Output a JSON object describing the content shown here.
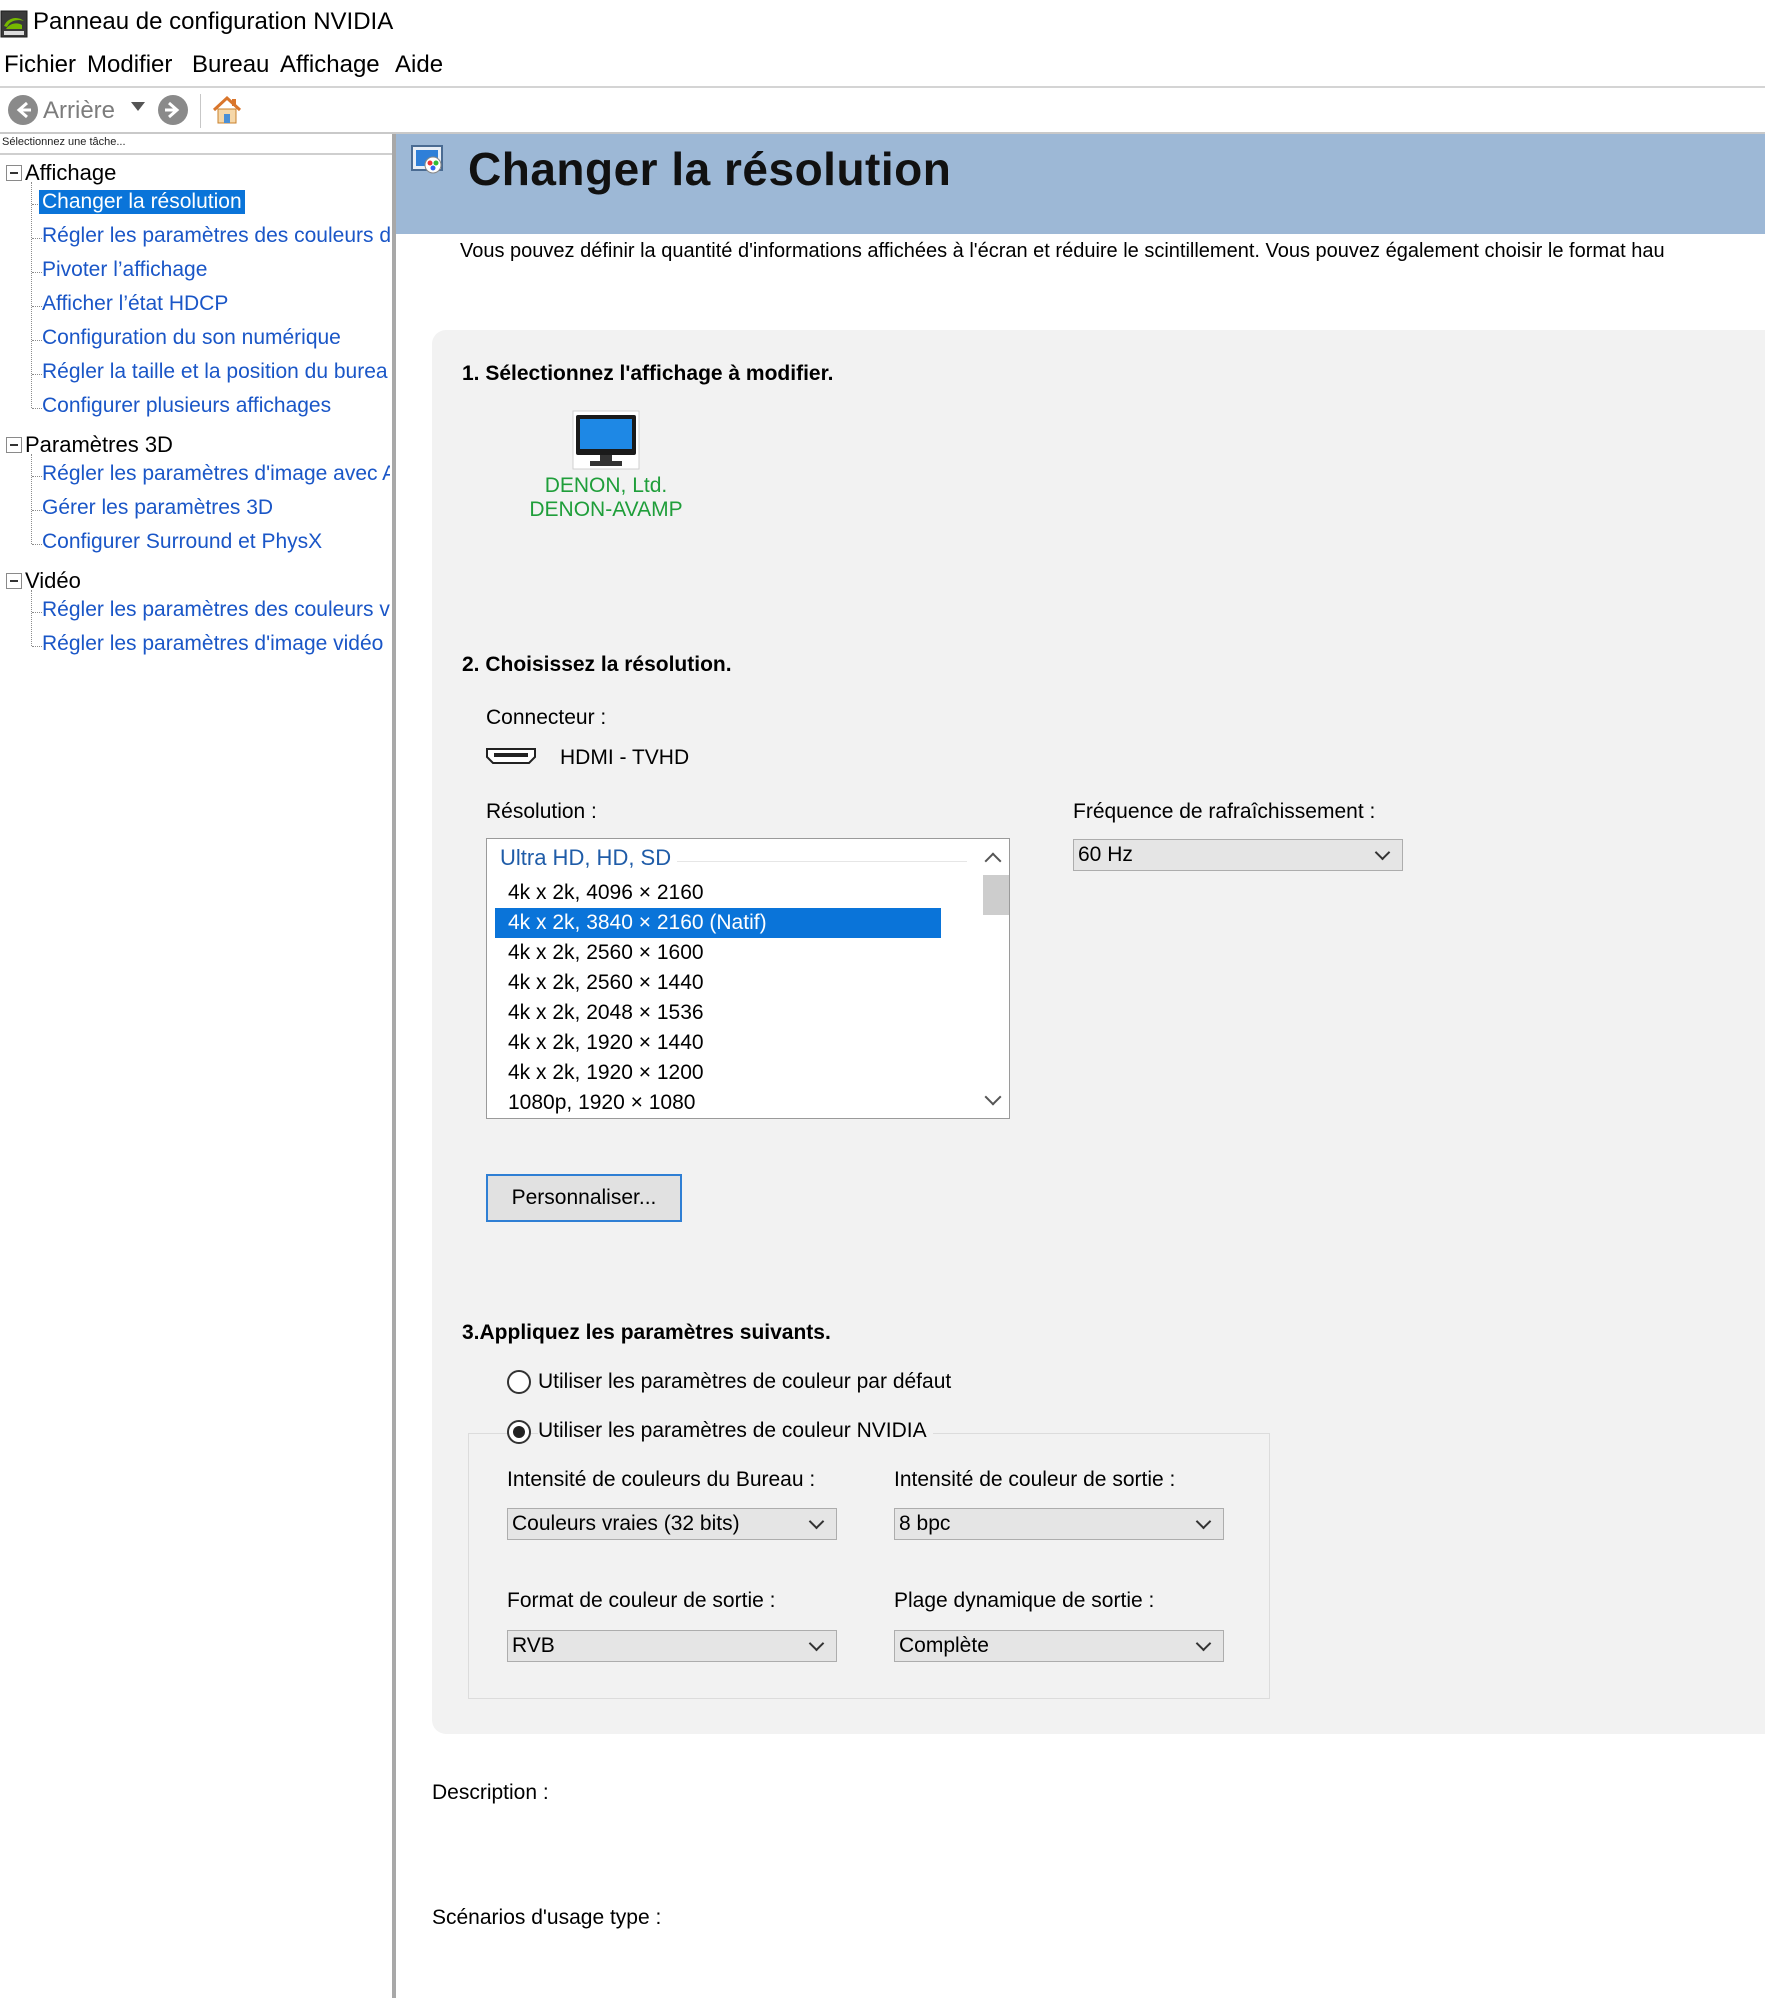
{
  "window": {
    "title": "Panneau de configuration NVIDIA"
  },
  "menu": [
    "Fichier",
    "Modifier",
    "Bureau",
    "Affichage",
    "Aide"
  ],
  "toolbar": {
    "back_label": "Arrière"
  },
  "left_pane": {
    "header": "Sélectionnez une tâche...",
    "categories": [
      {
        "label": "Affichage",
        "items": [
          "Changer la résolution",
          "Régler les paramètres des couleurs d",
          "Pivoter l’affichage",
          "Afficher l’état HDCP",
          "Configuration du son numérique",
          "Régler la taille et la position du burea",
          "Configurer plusieurs affichages"
        ]
      },
      {
        "label": "Paramètres 3D",
        "items": [
          "Régler les paramètres d'image avec A",
          "Gérer les paramètres 3D",
          "Configurer Surround et PhysX"
        ]
      },
      {
        "label": "Vidéo",
        "items": [
          "Régler les paramètres des couleurs v",
          "Régler les paramètres d'image vidéo"
        ]
      }
    ],
    "selected_item": "Changer la résolution"
  },
  "page": {
    "title": "Changer la résolution",
    "intro": "Vous pouvez définir la quantité d'informations affichées à l'écran et réduire le scintillement. Vous pouvez également choisir le format hau",
    "step1": {
      "title": "1. Sélectionnez l'affichage à modifier.",
      "display_line1": "DENON, Ltd.",
      "display_line2": "DENON-AVAMP"
    },
    "step2": {
      "title": "2. Choisissez la résolution.",
      "connector_label": "Connecteur :",
      "connector_value": "HDMI - TVHD",
      "resolution_label": "Résolution :",
      "resolution_group": "Ultra HD, HD, SD",
      "resolutions": [
        "4k x 2k, 4096 × 2160",
        "4k x 2k, 3840 × 2160 (Natif)",
        "4k x 2k, 2560 × 1600",
        "4k x 2k, 2560 × 1440",
        "4k x 2k, 2048 × 1536",
        "4k x 2k, 1920 × 1440",
        "4k x 2k, 1920 × 1200",
        "1080p, 1920 × 1080"
      ],
      "selected_resolution": "4k x 2k, 3840 × 2160 (Natif)",
      "refresh_label": "Fréquence de rafraîchissement :",
      "refresh_value": "60 Hz",
      "customize_button": "Personnaliser..."
    },
    "step3": {
      "title": "3.Appliquez les paramètres suivants.",
      "radio_default": "Utiliser les paramètres de couleur par défaut",
      "radio_nvidia": "Utiliser les paramètres de couleur NVIDIA",
      "selected_radio": "nvidia",
      "desktop_depth_label": "Intensité de couleurs du Bureau :",
      "desktop_depth_value": "Couleurs vraies (32 bits)",
      "output_depth_label": "Intensité de couleur de sortie :",
      "output_depth_value": "8 bpc",
      "output_format_label": "Format de couleur de sortie :",
      "output_format_value": "RVB",
      "output_range_label": "Plage dynamique de sortie :",
      "output_range_value": "Complète"
    },
    "description_label": "Description :",
    "usage_label": "Scénarios d'usage type :"
  },
  "colors": {
    "header_band": "#9db8d6",
    "selection": "#0a74d9",
    "link": "#1a56c7",
    "display_name": "#1f9e3a"
  }
}
